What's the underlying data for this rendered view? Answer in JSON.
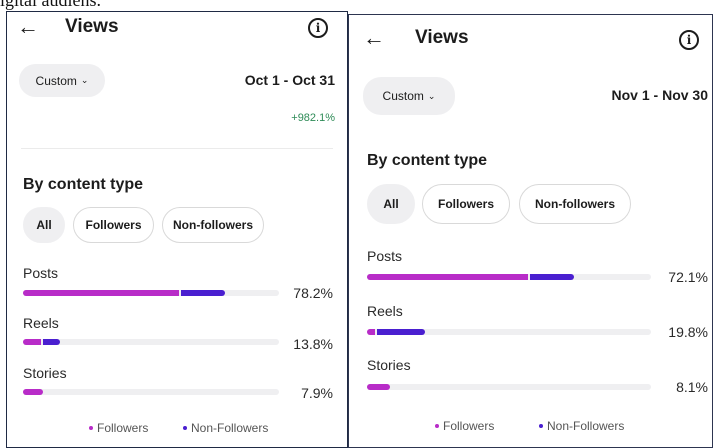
{
  "caption": "igital audiens.",
  "colors": {
    "followers": "#b82cc8",
    "non_followers": "#4a1fd0",
    "delta": "#2e8b57"
  },
  "panels": [
    {
      "title": "Views",
      "back_icon": "arrow-left-icon",
      "info_icon": "info-icon",
      "filter": "Custom",
      "date_range": "Oct 1 - Oct 31",
      "delta": "+982.1%",
      "section_title": "By content type",
      "chips": [
        "All",
        "Followers",
        "Non-followers"
      ],
      "selected_chip": "All",
      "rows": [
        {
          "label": "Posts",
          "percent": "78.2%",
          "followers_share": 0.609,
          "non_followers_share": 0.173
        },
        {
          "label": "Reels",
          "percent": "13.8%",
          "followers_share": 0.07,
          "non_followers_share": 0.068
        },
        {
          "label": "Stories",
          "percent": "7.9%",
          "followers_share": 0.079,
          "non_followers_share": 0.0
        }
      ],
      "legend": [
        "Followers",
        "Non-Followers"
      ]
    },
    {
      "title": "Views",
      "back_icon": "arrow-left-icon",
      "info_icon": "info-icon",
      "filter": "Custom",
      "date_range": "Nov 1 - Nov 30",
      "section_title": "By content type",
      "chips": [
        "All",
        "Followers",
        "Non-followers"
      ],
      "selected_chip": "All",
      "rows": [
        {
          "label": "Posts",
          "percent": "72.1%",
          "followers_share": 0.567,
          "non_followers_share": 0.154
        },
        {
          "label": "Reels",
          "percent": "19.8%",
          "followers_share": 0.028,
          "non_followers_share": 0.17
        },
        {
          "label": "Stories",
          "percent": "8.1%",
          "followers_share": 0.081,
          "non_followers_share": 0.0
        }
      ],
      "legend": [
        "Followers",
        "Non-Followers"
      ]
    }
  ]
}
